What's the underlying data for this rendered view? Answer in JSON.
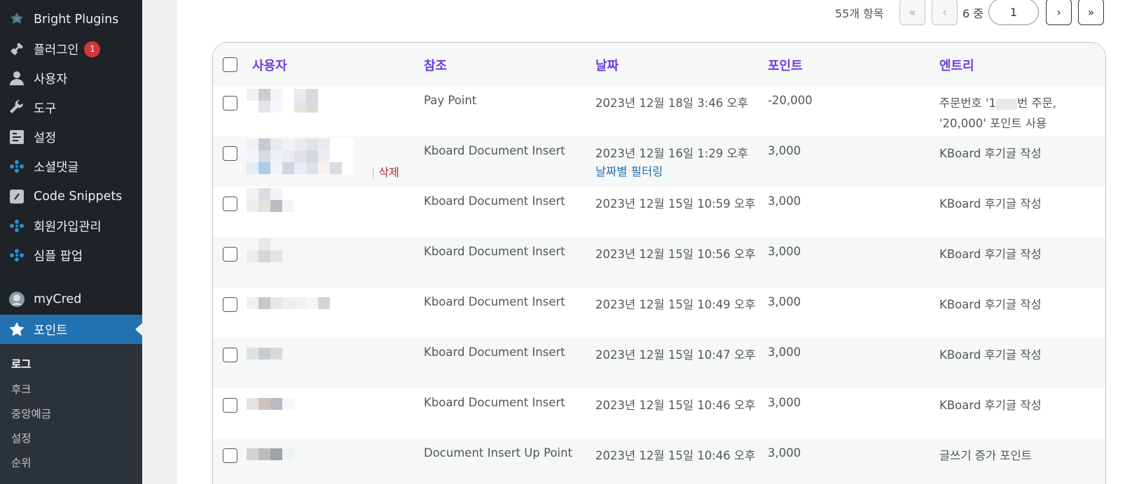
{
  "sidebar": {
    "items": [
      {
        "label": "Bright Plugins",
        "icon": "bright-plugins-icon"
      },
      {
        "label": "플러그인",
        "icon": "plugin-icon",
        "badge": "1"
      },
      {
        "label": "사용자",
        "icon": "user-icon"
      },
      {
        "label": "도구",
        "icon": "wrench-icon"
      },
      {
        "label": "설정",
        "icon": "settings-icon"
      },
      {
        "label": "소셜댓글",
        "icon": "dots-icon"
      },
      {
        "label": "Code Snippets",
        "icon": "code-snippets-icon"
      },
      {
        "label": "회원가입관리",
        "icon": "dots-icon"
      },
      {
        "label": "심플 팝업",
        "icon": "dots-icon"
      },
      {
        "label": "myCred",
        "icon": "mycred-avatar-icon"
      },
      {
        "label": "포인트",
        "icon": "star-icon",
        "active": true
      }
    ],
    "submenu": [
      {
        "label": "로그",
        "current": true
      },
      {
        "label": "후크"
      },
      {
        "label": "중앙예금"
      },
      {
        "label": "설정"
      },
      {
        "label": "순위"
      }
    ]
  },
  "pagination": {
    "count_label": "55개 항목",
    "first": "«",
    "prev": "‹",
    "of_label": "6 중",
    "current_page": "1",
    "next": "›",
    "last": "»"
  },
  "table": {
    "headers": {
      "user": "사용자",
      "ref": "참조",
      "date": "날짜",
      "points": "포인트",
      "entry": "엔트리"
    },
    "rows": [
      {
        "ref": "Pay Point",
        "date": "2023년 12월 18일 3:46 오후",
        "points": "-20,000",
        "entry1": "주문번호 '1",
        "entry1b": "번 주문,",
        "entry2": "'20,000' 포인트 사용"
      },
      {
        "ref": "Kboard Document Insert",
        "date": "2023년 12월 16일 1:29 오후",
        "date_link": "날짜별 필터링",
        "points": "3,000",
        "entry1": "KBoard 후기글 작성",
        "action_sep": "|",
        "action_delete": "삭제"
      },
      {
        "ref": "Kboard Document Insert",
        "date": "2023년 12월 15일 10:59 오후",
        "points": "3,000",
        "entry1": "KBoard 후기글 작성"
      },
      {
        "ref": "Kboard Document Insert",
        "date": "2023년 12월 15일 10:56 오후",
        "points": "3,000",
        "entry1": "KBoard 후기글 작성"
      },
      {
        "ref": "Kboard Document Insert",
        "date": "2023년 12월 15일 10:49 오후",
        "points": "3,000",
        "entry1": "KBoard 후기글 작성"
      },
      {
        "ref": "Kboard Document Insert",
        "date": "2023년 12월 15일 10:47 오후",
        "points": "3,000",
        "entry1": "KBoard 후기글 작성"
      },
      {
        "ref": "Kboard Document Insert",
        "date": "2023년 12월 15일 10:46 오후",
        "points": "3,000",
        "entry1": "KBoard 후기글 작성"
      },
      {
        "ref": "Document Insert Up Point",
        "date": "2023년 12월 15일 10:46 오후",
        "points": "3,000",
        "entry1": "글쓰기 증가 포인트"
      }
    ]
  },
  "colors": {
    "sidebar_bg": "#1d2327",
    "active_bg": "#2271b1",
    "header_text": "#6b3fe0",
    "badge": "#d63638"
  }
}
